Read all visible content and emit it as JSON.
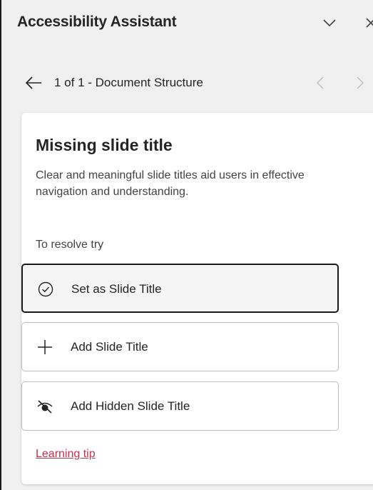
{
  "header": {
    "title": "Accessibility Assistant",
    "collapse_icon": "chevron-down-icon",
    "close_icon": "close-icon"
  },
  "nav": {
    "back_icon": "arrow-left-icon",
    "position_label": "1 of 1 - Document Structure",
    "prev_icon": "chevron-left-icon",
    "next_icon": "chevron-right-icon"
  },
  "issue": {
    "title": "Missing slide title",
    "description": "Clear and meaningful slide titles aid users in effective navigation and understanding.",
    "resolve_label": "To resolve try",
    "actions": [
      {
        "label": "Set as Slide Title",
        "icon": "check-circle-icon",
        "selected": true
      },
      {
        "label": "Add Slide Title",
        "icon": "plus-icon",
        "selected": false
      },
      {
        "label": "Add Hidden Slide Title",
        "icon": "eye-off-icon",
        "selected": false
      }
    ],
    "learning_tip": "Learning tip"
  },
  "colors": {
    "link": "#c4314b",
    "background": "#f0f0f0",
    "card": "#ffffff"
  }
}
